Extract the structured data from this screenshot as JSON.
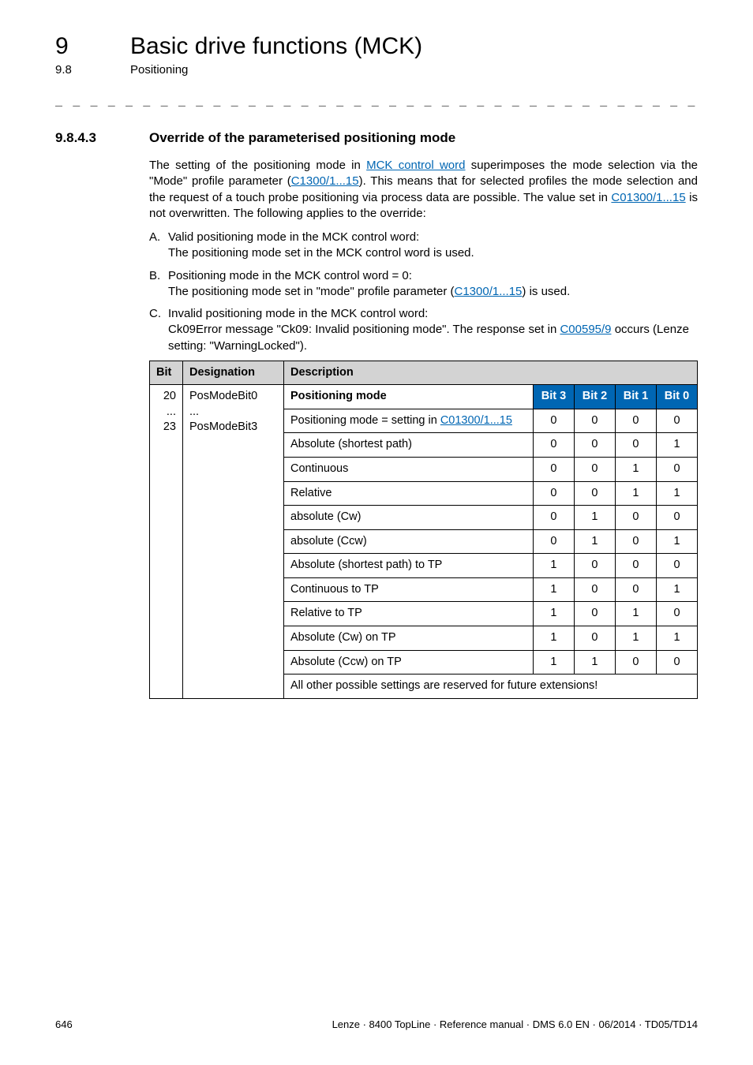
{
  "chapter": {
    "num": "9",
    "title": "Basic drive functions (MCK)"
  },
  "section": {
    "num": "9.8",
    "title": "Positioning"
  },
  "dashes": "_ _ _ _ _ _ _ _ _ _ _ _ _ _ _ _ _ _ _ _ _ _ _ _ _ _ _ _ _ _ _ _ _ _ _ _ _ _ _ _ _ _ _ _ _ _ _ _ _ _ _ _ _ _ _ _ _ _ _ _ _ _ _ _",
  "heading": {
    "num": "9.8.4.3",
    "title": "Override of the parameterised positioning mode"
  },
  "para": {
    "p1a": "The setting of the positioning mode in ",
    "p1_link1": "MCK control word",
    "p1b": " superimposes the mode selection via the \"Mode\" profile parameter (",
    "p1_link2": "C1300/1...15",
    "p1c": "). This means that for selected profiles the mode selection and the request of a touch probe positioning via process data are possible. The value set in ",
    "p1_link3": "C01300/1...15",
    "p1d": " is not overwritten. The following applies to the override:"
  },
  "list": {
    "a_marker": "A.",
    "a_l1": "Valid positioning mode in the MCK control word:",
    "a_l2": "The positioning mode set in the MCK control word is used.",
    "b_marker": "B.",
    "b_l1": "Positioning mode in the MCK control word = 0:",
    "b_l2a": "The positioning mode set in \"mode\" profile parameter (",
    "b_link": "C1300/1...15",
    "b_l2b": ") is used.",
    "c_marker": "C.",
    "c_l1": "Invalid positioning mode in the MCK control word:",
    "c_l2a": "Ck09Error message \"Ck09: Invalid positioning mode\". The response set in ",
    "c_link": "C00595/9",
    "c_l2b": " occurs (Lenze setting: \"WarningLocked\")."
  },
  "table": {
    "header": {
      "bit": "Bit",
      "designation": "Designation",
      "description": "Description"
    },
    "bits_label_a": "20",
    "bits_label_dots": "...",
    "bits_label_b": "23",
    "desig_a": "PosModeBit0",
    "desig_dots": "...",
    "desig_b": "PosModeBit3",
    "posmode_label": "Positioning mode",
    "bit_headers": {
      "b3": "Bit 3",
      "b2": "Bit 2",
      "b1": "Bit 1",
      "b0": "Bit 0"
    },
    "rows": [
      {
        "desc_a": "Positioning mode = setting in ",
        "link": "C01300/1...15",
        "desc_b": "",
        "b3": "0",
        "b2": "0",
        "b1": "0",
        "b0": "0"
      },
      {
        "desc_a": "Absolute (shortest path)",
        "link": "",
        "desc_b": "",
        "b3": "0",
        "b2": "0",
        "b1": "0",
        "b0": "1"
      },
      {
        "desc_a": "Continuous",
        "link": "",
        "desc_b": "",
        "b3": "0",
        "b2": "0",
        "b1": "1",
        "b0": "0"
      },
      {
        "desc_a": "Relative",
        "link": "",
        "desc_b": "",
        "b3": "0",
        "b2": "0",
        "b1": "1",
        "b0": "1"
      },
      {
        "desc_a": "absolute (Cw)",
        "link": "",
        "desc_b": "",
        "b3": "0",
        "b2": "1",
        "b1": "0",
        "b0": "0"
      },
      {
        "desc_a": "absolute (Ccw)",
        "link": "",
        "desc_b": "",
        "b3": "0",
        "b2": "1",
        "b1": "0",
        "b0": "1"
      },
      {
        "desc_a": "Absolute (shortest path) to TP",
        "link": "",
        "desc_b": "",
        "b3": "1",
        "b2": "0",
        "b1": "0",
        "b0": "0"
      },
      {
        "desc_a": "Continuous to TP",
        "link": "",
        "desc_b": "",
        "b3": "1",
        "b2": "0",
        "b1": "0",
        "b0": "1"
      },
      {
        "desc_a": "Relative to TP",
        "link": "",
        "desc_b": "",
        "b3": "1",
        "b2": "0",
        "b1": "1",
        "b0": "0"
      },
      {
        "desc_a": "Absolute (Cw) on TP",
        "link": "",
        "desc_b": "",
        "b3": "1",
        "b2": "0",
        "b1": "1",
        "b0": "1"
      },
      {
        "desc_a": "Absolute (Ccw) on TP",
        "link": "",
        "desc_b": "",
        "b3": "1",
        "b2": "1",
        "b1": "0",
        "b0": "0"
      }
    ],
    "footer_note": "All other possible settings are reserved for future extensions!"
  },
  "footer": {
    "page": "646",
    "meta": "Lenze · 8400 TopLine · Reference manual · DMS 6.0 EN · 06/2014 · TD05/TD14"
  }
}
